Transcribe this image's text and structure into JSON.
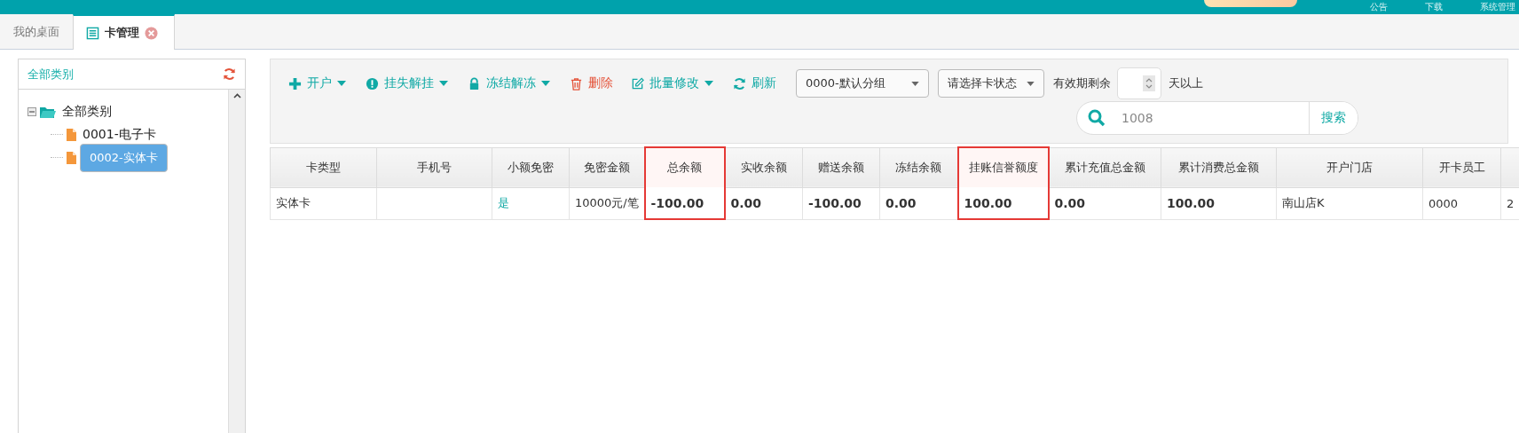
{
  "top_bar": {
    "links": [
      "公告",
      "下载",
      "系统管理"
    ]
  },
  "tabs": [
    {
      "label": "我的桌面",
      "selected": false,
      "closable": false
    },
    {
      "label": "卡管理",
      "selected": true,
      "closable": true
    }
  ],
  "sidebar": {
    "title": "全部类别",
    "tree": [
      {
        "label": "全部类别",
        "kind": "folder",
        "expanded": true,
        "selected": false,
        "children": [
          {
            "label": "0001-电子卡",
            "kind": "file",
            "selected": false
          },
          {
            "label": "0002-实体卡",
            "kind": "file",
            "selected": true
          }
        ]
      }
    ]
  },
  "toolbar": {
    "buttons": [
      {
        "label": "开户",
        "kind": "plus",
        "has_menu": true,
        "danger": false
      },
      {
        "label": "挂失解挂",
        "kind": "alert",
        "has_menu": true,
        "danger": false
      },
      {
        "label": "冻结解冻",
        "kind": "lock",
        "has_menu": true,
        "danger": false
      },
      {
        "label": "删除",
        "kind": "trash",
        "has_menu": false,
        "danger": true
      },
      {
        "label": "批量修改",
        "kind": "edit",
        "has_menu": true,
        "danger": false
      },
      {
        "label": "刷新",
        "kind": "refresh",
        "has_menu": false,
        "danger": false
      }
    ],
    "group_select": "0000-默认分组",
    "status_select": "请选择卡状态",
    "expiry_label": "有效期剩余",
    "expiry_suffix": "天以上",
    "search": {
      "value": "1008",
      "button": "搜索"
    }
  },
  "table": {
    "columns": [
      {
        "label": "卡类型",
        "highlighted": false
      },
      {
        "label": "手机号",
        "highlighted": false
      },
      {
        "label": "小额免密",
        "highlighted": false
      },
      {
        "label": "免密金额",
        "highlighted": false
      },
      {
        "label": "总余额",
        "highlighted": true
      },
      {
        "label": "实收余额",
        "highlighted": false
      },
      {
        "label": "赠送余额",
        "highlighted": false
      },
      {
        "label": "冻结余额",
        "highlighted": false
      },
      {
        "label": "挂账信誉额度",
        "highlighted": true
      },
      {
        "label": "累计充值总金额",
        "highlighted": false
      },
      {
        "label": "累计消费总金额",
        "highlighted": false
      },
      {
        "label": "开户门店",
        "highlighted": false
      },
      {
        "label": "开卡员工",
        "highlighted": false
      }
    ],
    "rows": [
      {
        "cells": [
          {
            "text": "实体卡",
            "kind": "text"
          },
          {
            "text": "",
            "kind": "text"
          },
          {
            "text": "是",
            "kind": "link"
          },
          {
            "text": "10000元/笔",
            "kind": "text"
          },
          {
            "text": "-100.00",
            "kind": "amount"
          },
          {
            "text": "0.00",
            "kind": "amount"
          },
          {
            "text": "-100.00",
            "kind": "amount"
          },
          {
            "text": "0.00",
            "kind": "amount"
          },
          {
            "text": "100.00",
            "kind": "amount"
          },
          {
            "text": "0.00",
            "kind": "amount"
          },
          {
            "text": "100.00",
            "kind": "amount"
          },
          {
            "text": "南山店K",
            "kind": "text"
          },
          {
            "text": "0000",
            "kind": "text"
          },
          {
            "text": "2",
            "kind": "text"
          }
        ]
      }
    ]
  }
}
